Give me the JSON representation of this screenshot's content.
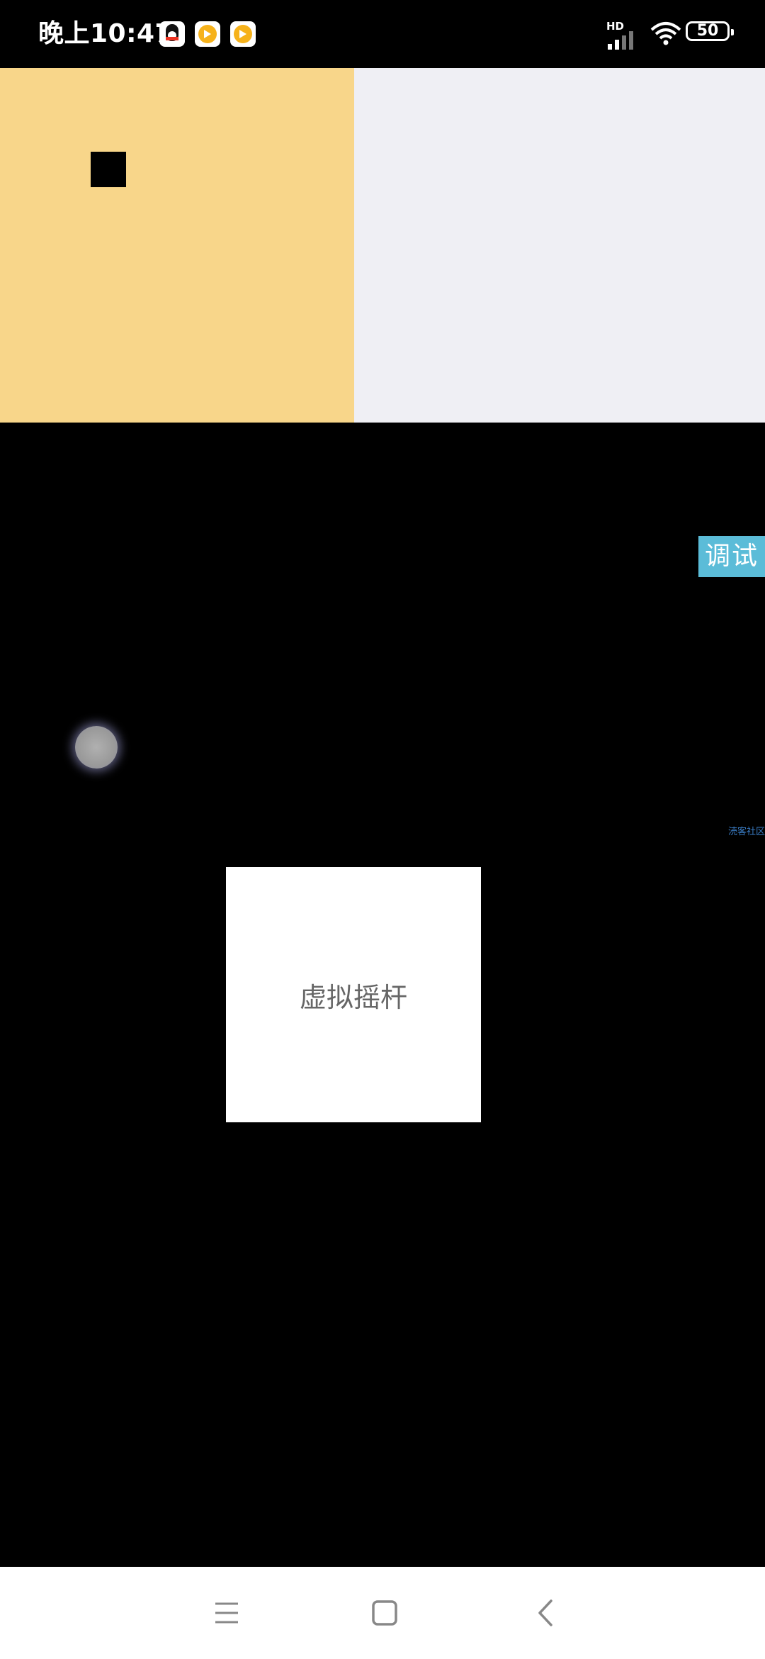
{
  "status_bar": {
    "time": "晚上10:47",
    "network_label": "HD",
    "battery_level": "50",
    "notification_icons": [
      "qq-icon",
      "app-icon",
      "app-icon"
    ]
  },
  "debug_button": {
    "label": "调试",
    "color": "#5bbcd8"
  },
  "watermark": {
    "text": "涜客社区"
  },
  "joystick": {
    "label": "虚拟摇杆"
  },
  "game": {
    "left_panel_color": "#f8d68a",
    "right_panel_color": "#efeff4"
  },
  "nav_bar": {
    "buttons": [
      "menu-icon",
      "home-icon",
      "back-icon"
    ]
  }
}
